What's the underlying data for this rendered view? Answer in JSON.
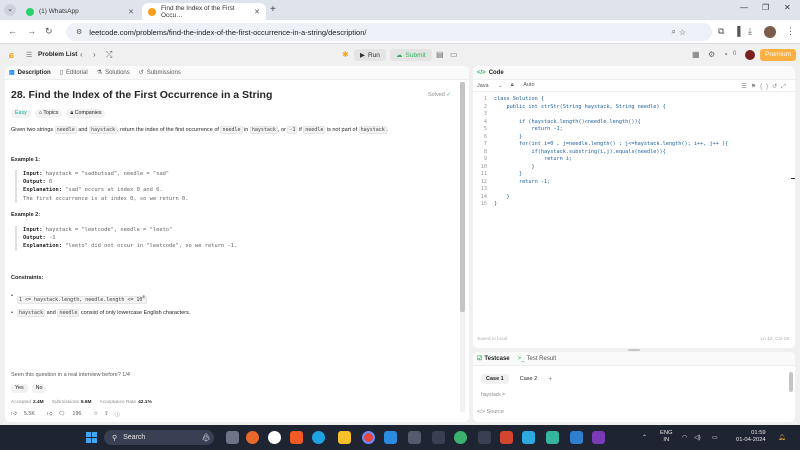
{
  "browser": {
    "tabs": [
      {
        "title": "(1) WhatsApp"
      },
      {
        "title": "Find the Index of the First Occu…"
      }
    ],
    "url": "leetcode.com/problems/find-the-index-of-the-first-occurrence-in-a-string/description/"
  },
  "lc_nav": {
    "problem_list": "Problem List",
    "run": "Run",
    "submit": "Submit",
    "streak": "0",
    "premium": "Premium"
  },
  "left": {
    "tabs": [
      "Description",
      "Editorial",
      "Solutions",
      "Submissions"
    ],
    "title": "28. Find the Index of the First Occurrence in a String",
    "solved": "Solved",
    "tags": [
      "Easy",
      "Topics",
      "Companies"
    ],
    "desc": {
      "p1": "Given two strings ",
      "needle": "needle",
      "p2": " and ",
      "haystack": "haystack",
      "p3": ", return the index of the first occurrence of ",
      "p4": " in ",
      "p5": ", or ",
      "neg": "-1",
      "p6": " if ",
      "p7": " is not part of ",
      "p8": "."
    },
    "examples": [
      {
        "label": "Example 1:",
        "input_k": "Input:",
        "input_v": " haystack = \"sadbutsad\", needle = \"sad\"",
        "output_k": "Output:",
        "output_v": " 0",
        "expl_k": "Explanation:",
        "expl_v": " \"sad\" occurs at index 0 and 6.",
        "expl_2": "The first occurrence is at index 0, so we return 0."
      },
      {
        "label": "Example 2:",
        "input_k": "Input:",
        "input_v": " haystack = \"leetcode\", needle = \"leeto\"",
        "output_k": "Output:",
        "output_v": " -1",
        "expl_k": "Explanation:",
        "expl_v": " \"leeto\" did not occur in \"leetcode\", so we return -1."
      }
    ],
    "constraints_label": "Constraints:",
    "constraint1": "1 <= haystack.length, needle.length <= 10",
    "constraint1_sup": "4",
    "constraint2_a": "haystack",
    "constraint2_b": " and ",
    "constraint2_c": "needle",
    "constraint2_d": " consist of only lowercase English characters.",
    "seen": "Seen this question in a real interview before?   1/4",
    "yes": "Yes",
    "no": "No",
    "accepted_k": "Accepted",
    "accepted_v": "2.4M",
    "submissions_k": "Submissions",
    "submissions_v": "5.6M",
    "rate_k": "Acceptance Rate",
    "rate_v": "42.1%",
    "likes": "5.5K",
    "comments": "196"
  },
  "code": {
    "header": "Code",
    "lang": "Java",
    "auto": "Auto",
    "lines": [
      "class Solution {",
      "    public int strStr(String haystack, String needle) {",
      "",
      "        if (haystack.length()<needle.length()){",
      "            return -1;",
      "        }",
      "        for(int i=0 , j=needle.length() ; j<=haystack.length(); i++, j++ ){",
      "            if(haystack.substring(i,j).equals(needle)){",
      "                return i;",
      "            }",
      "        }",
      "        return -1;",
      "",
      "    }",
      "}"
    ],
    "saved": "Saved to local",
    "position": "Ln 12, Col 18"
  },
  "testcase": {
    "tab1": "Testcase",
    "tab2": "Test Result",
    "cases": [
      "Case 1",
      "Case 2"
    ],
    "var_label": "haystack =",
    "source": "Source"
  },
  "taskbar": {
    "search": "Search",
    "lang1": "ENG",
    "lang2": "IN",
    "time": "01:59",
    "date": "01-04-2024"
  }
}
